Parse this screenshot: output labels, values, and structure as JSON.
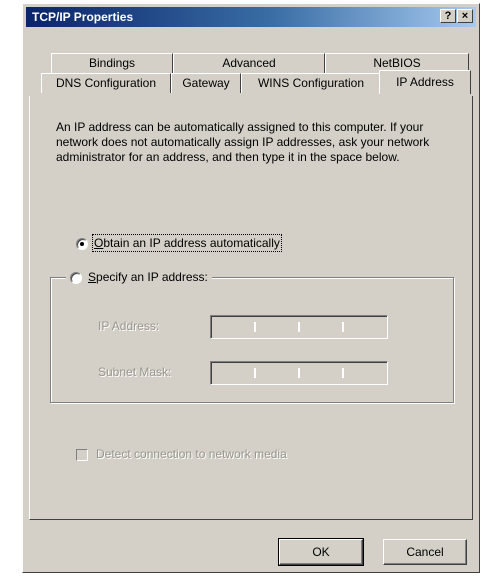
{
  "window": {
    "title": "TCP/IP Properties",
    "help_button": "?",
    "close_button": "×"
  },
  "tabs": {
    "row1": [
      "Bindings",
      "Advanced",
      "NetBIOS"
    ],
    "row2": [
      "DNS Configuration",
      "Gateway",
      "WINS Configuration",
      "IP Address"
    ],
    "active": "IP Address"
  },
  "panel": {
    "description": "An IP address can be automatically assigned to this computer. If your network does not automatically assign IP addresses, ask your network administrator for an address, and then type it in the space below.",
    "obtain_automatically": {
      "label_accel": "O",
      "label_rest": "btain an IP address automatically",
      "selected": true
    },
    "specify_address": {
      "label_accel": "S",
      "label_rest": "pecify an IP address:",
      "selected": false
    },
    "ip_address_label": "IP Address:",
    "subnet_mask_label": "Subnet Mask:",
    "detect_connection_label": "Detect connection to network media"
  },
  "buttons": {
    "ok": "OK",
    "cancel": "Cancel"
  },
  "colors": {
    "face": "#d4d0c8",
    "titlebar_start": "#0a246a",
    "titlebar_end": "#a6caf0",
    "disabled_text": "#9a968e"
  }
}
